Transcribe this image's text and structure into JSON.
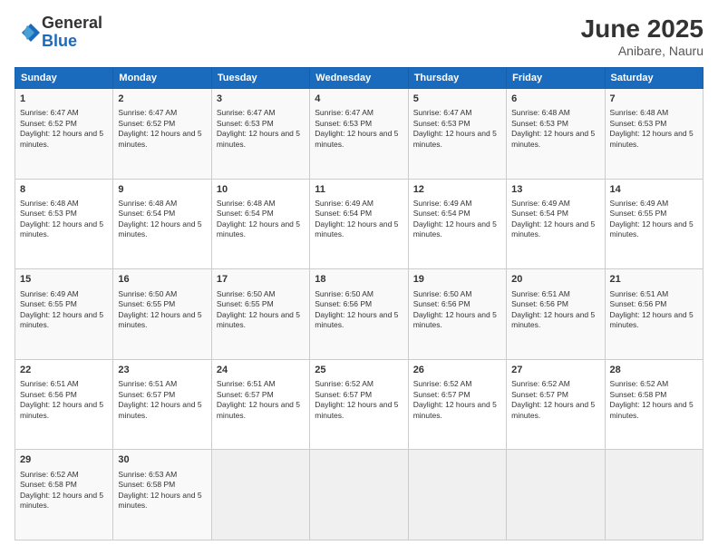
{
  "header": {
    "logo_general": "General",
    "logo_blue": "Blue",
    "month_year": "June 2025",
    "location": "Anibare, Nauru"
  },
  "weekdays": [
    "Sunday",
    "Monday",
    "Tuesday",
    "Wednesday",
    "Thursday",
    "Friday",
    "Saturday"
  ],
  "weeks": [
    [
      {
        "day": "1",
        "sunrise": "6:47 AM",
        "sunset": "6:52 PM",
        "daylight": "12 hours and 5 minutes."
      },
      {
        "day": "2",
        "sunrise": "6:47 AM",
        "sunset": "6:52 PM",
        "daylight": "12 hours and 5 minutes."
      },
      {
        "day": "3",
        "sunrise": "6:47 AM",
        "sunset": "6:53 PM",
        "daylight": "12 hours and 5 minutes."
      },
      {
        "day": "4",
        "sunrise": "6:47 AM",
        "sunset": "6:53 PM",
        "daylight": "12 hours and 5 minutes."
      },
      {
        "day": "5",
        "sunrise": "6:47 AM",
        "sunset": "6:53 PM",
        "daylight": "12 hours and 5 minutes."
      },
      {
        "day": "6",
        "sunrise": "6:48 AM",
        "sunset": "6:53 PM",
        "daylight": "12 hours and 5 minutes."
      },
      {
        "day": "7",
        "sunrise": "6:48 AM",
        "sunset": "6:53 PM",
        "daylight": "12 hours and 5 minutes."
      }
    ],
    [
      {
        "day": "8",
        "sunrise": "6:48 AM",
        "sunset": "6:53 PM",
        "daylight": "12 hours and 5 minutes."
      },
      {
        "day": "9",
        "sunrise": "6:48 AM",
        "sunset": "6:54 PM",
        "daylight": "12 hours and 5 minutes."
      },
      {
        "day": "10",
        "sunrise": "6:48 AM",
        "sunset": "6:54 PM",
        "daylight": "12 hours and 5 minutes."
      },
      {
        "day": "11",
        "sunrise": "6:49 AM",
        "sunset": "6:54 PM",
        "daylight": "12 hours and 5 minutes."
      },
      {
        "day": "12",
        "sunrise": "6:49 AM",
        "sunset": "6:54 PM",
        "daylight": "12 hours and 5 minutes."
      },
      {
        "day": "13",
        "sunrise": "6:49 AM",
        "sunset": "6:54 PM",
        "daylight": "12 hours and 5 minutes."
      },
      {
        "day": "14",
        "sunrise": "6:49 AM",
        "sunset": "6:55 PM",
        "daylight": "12 hours and 5 minutes."
      }
    ],
    [
      {
        "day": "15",
        "sunrise": "6:49 AM",
        "sunset": "6:55 PM",
        "daylight": "12 hours and 5 minutes."
      },
      {
        "day": "16",
        "sunrise": "6:50 AM",
        "sunset": "6:55 PM",
        "daylight": "12 hours and 5 minutes."
      },
      {
        "day": "17",
        "sunrise": "6:50 AM",
        "sunset": "6:55 PM",
        "daylight": "12 hours and 5 minutes."
      },
      {
        "day": "18",
        "sunrise": "6:50 AM",
        "sunset": "6:56 PM",
        "daylight": "12 hours and 5 minutes."
      },
      {
        "day": "19",
        "sunrise": "6:50 AM",
        "sunset": "6:56 PM",
        "daylight": "12 hours and 5 minutes."
      },
      {
        "day": "20",
        "sunrise": "6:51 AM",
        "sunset": "6:56 PM",
        "daylight": "12 hours and 5 minutes."
      },
      {
        "day": "21",
        "sunrise": "6:51 AM",
        "sunset": "6:56 PM",
        "daylight": "12 hours and 5 minutes."
      }
    ],
    [
      {
        "day": "22",
        "sunrise": "6:51 AM",
        "sunset": "6:56 PM",
        "daylight": "12 hours and 5 minutes."
      },
      {
        "day": "23",
        "sunrise": "6:51 AM",
        "sunset": "6:57 PM",
        "daylight": "12 hours and 5 minutes."
      },
      {
        "day": "24",
        "sunrise": "6:51 AM",
        "sunset": "6:57 PM",
        "daylight": "12 hours and 5 minutes."
      },
      {
        "day": "25",
        "sunrise": "6:52 AM",
        "sunset": "6:57 PM",
        "daylight": "12 hours and 5 minutes."
      },
      {
        "day": "26",
        "sunrise": "6:52 AM",
        "sunset": "6:57 PM",
        "daylight": "12 hours and 5 minutes."
      },
      {
        "day": "27",
        "sunrise": "6:52 AM",
        "sunset": "6:57 PM",
        "daylight": "12 hours and 5 minutes."
      },
      {
        "day": "28",
        "sunrise": "6:52 AM",
        "sunset": "6:58 PM",
        "daylight": "12 hours and 5 minutes."
      }
    ],
    [
      {
        "day": "29",
        "sunrise": "6:52 AM",
        "sunset": "6:58 PM",
        "daylight": "12 hours and 5 minutes."
      },
      {
        "day": "30",
        "sunrise": "6:53 AM",
        "sunset": "6:58 PM",
        "daylight": "12 hours and 5 minutes."
      },
      null,
      null,
      null,
      null,
      null
    ]
  ]
}
